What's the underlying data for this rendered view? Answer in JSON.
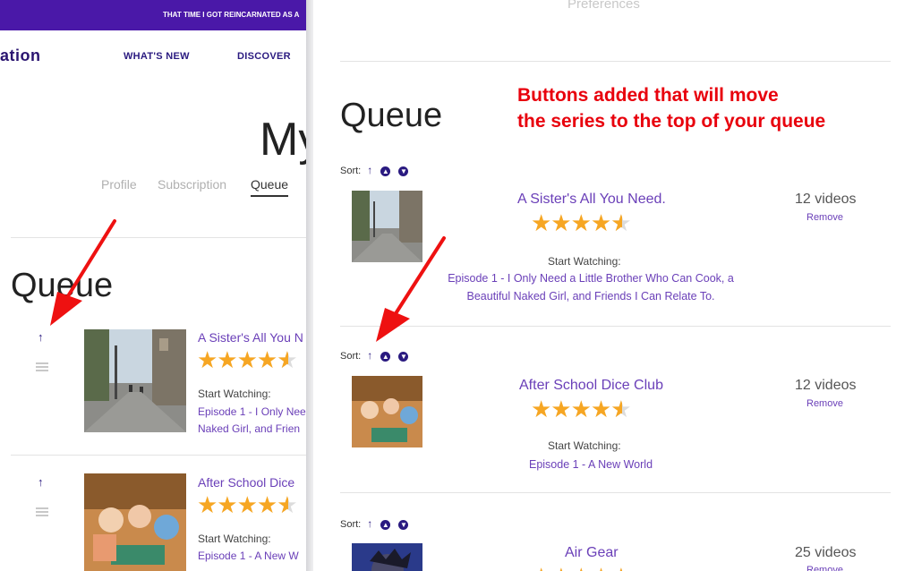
{
  "left_panel": {
    "promo_text": "THAT TIME I GOT REINCARNATED AS A",
    "logo_text": "ation",
    "nav": [
      "WHAT'S NEW",
      "DISCOVER"
    ],
    "page_title": "My",
    "profile_tabs": [
      "Profile",
      "Subscription",
      "Queue"
    ],
    "queue_heading": "Queue",
    "items": [
      {
        "title": "A Sister's All You N",
        "rating": 4.5,
        "start_label": "Start Watching:",
        "episode_lines": [
          "Episode 1 - I Only Nee",
          "Naked Girl, and Frien"
        ]
      },
      {
        "title": "After School Dice",
        "rating": 4.5,
        "start_label": "Start Watching:",
        "episode_lines": [
          "Episode 1 - A New W"
        ]
      }
    ]
  },
  "right_panel": {
    "top_link": "Preferences",
    "queue_heading": "Queue",
    "annotation": [
      "Buttons added that will move",
      "the series to the top of your queue"
    ],
    "sort_label": "Sort:",
    "remove_label": "Remove",
    "start_label": "Start Watching:",
    "items": [
      {
        "title": "A Sister's All You Need.",
        "rating": 4.5,
        "videos": "12 videos",
        "episode": "Episode 1 - I Only Need a Little Brother Who Can Cook, a Beautiful Naked Girl, and Friends I Can Relate To."
      },
      {
        "title": "After School Dice Club",
        "rating": 4.5,
        "videos": "12 videos",
        "episode": "Episode 1 - A New World"
      },
      {
        "title": "Air Gear",
        "rating": 4.5,
        "videos": "25 videos",
        "episode": ""
      }
    ]
  },
  "colors": {
    "brand_purple": "#4a18a8",
    "link_purple": "#6a3fb8",
    "star_orange": "#f6a623",
    "annotation_red": "#e8000c"
  }
}
